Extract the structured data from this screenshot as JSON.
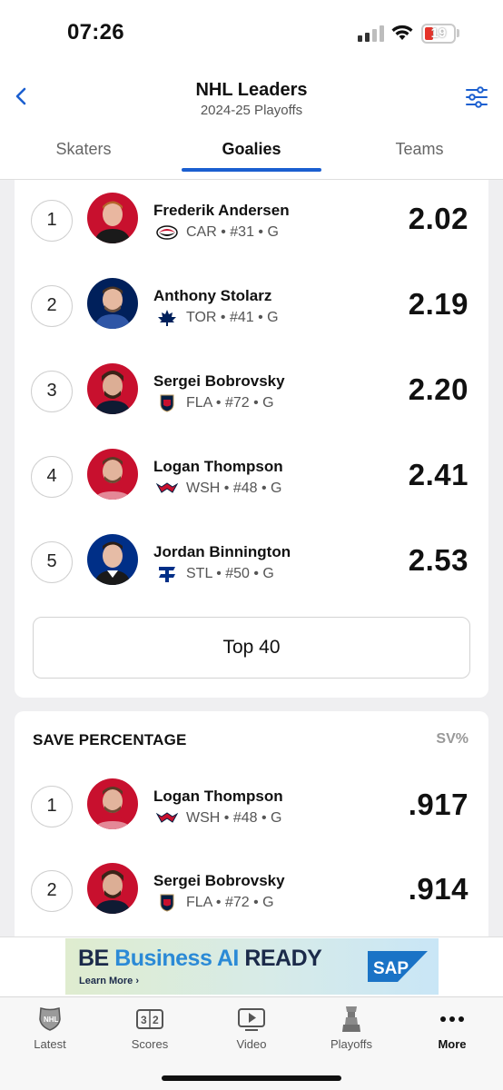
{
  "status": {
    "time": "07:26",
    "battery": "19"
  },
  "header": {
    "title": "NHL Leaders",
    "subtitle": "2024-25 Playoffs"
  },
  "tabs": [
    {
      "label": "Skaters",
      "active": false
    },
    {
      "label": "Goalies",
      "active": true
    },
    {
      "label": "Teams",
      "active": false
    }
  ],
  "gaa_list": {
    "rows": [
      {
        "rank": "1",
        "name": "Frederik Andersen",
        "team": "CAR",
        "meta": "CAR • #31 • G",
        "value": "2.02",
        "team_color": "#c8102e"
      },
      {
        "rank": "2",
        "name": "Anthony Stolarz",
        "team": "TOR",
        "meta": "TOR • #41 • G",
        "value": "2.19",
        "team_color": "#00205b"
      },
      {
        "rank": "3",
        "name": "Sergei Bobrovsky",
        "team": "FLA",
        "meta": "FLA • #72 • G",
        "value": "2.20",
        "team_color": "#c8102e"
      },
      {
        "rank": "4",
        "name": "Logan Thompson",
        "team": "WSH",
        "meta": "WSH • #48 • G",
        "value": "2.41",
        "team_color": "#c8102e"
      },
      {
        "rank": "5",
        "name": "Jordan Binnington",
        "team": "STL",
        "meta": "STL • #50 • G",
        "value": "2.53",
        "team_color": "#002f87"
      }
    ],
    "more_button": "Top 40"
  },
  "save_pct": {
    "title": "SAVE PERCENTAGE",
    "column": "SV%",
    "rows": [
      {
        "rank": "1",
        "name": "Logan Thompson",
        "team": "WSH",
        "meta": "WSH • #48 • G",
        "value": ".917",
        "team_color": "#c8102e"
      },
      {
        "rank": "2",
        "name": "Sergei Bobrovsky",
        "team": "FLA",
        "meta": "FLA • #72 • G",
        "value": ".914",
        "team_color": "#c8102e"
      }
    ]
  },
  "ad": {
    "word1": "BE",
    "word2": "Business AI",
    "word3": "READY",
    "cta": "Learn More ›",
    "brand": "SAP"
  },
  "tab_bar": [
    {
      "label": "Latest",
      "icon": "nhl-shield-icon"
    },
    {
      "label": "Scores",
      "icon": "scoreboard-icon"
    },
    {
      "label": "Video",
      "icon": "video-play-icon"
    },
    {
      "label": "Playoffs",
      "icon": "stanley-cup-icon"
    },
    {
      "label": "More",
      "icon": "more-dots-icon"
    }
  ],
  "colors": {
    "accent": "#1b5fd0",
    "negative": "#e5332a"
  }
}
